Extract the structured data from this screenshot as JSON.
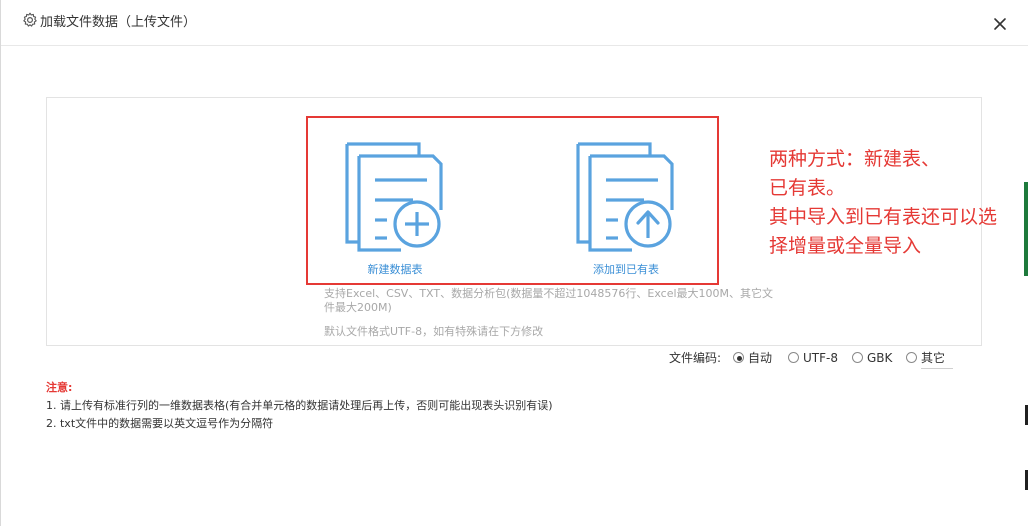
{
  "dialog": {
    "title": "加载文件数据（上传文件）",
    "title_icon": "gear-icon",
    "close_icon": "close-icon"
  },
  "upload": {
    "new_table_label": "新建数据表",
    "add_existing_label": "添加到已有表",
    "new_table_icon": "document-plus-icon",
    "add_existing_icon": "document-upload-icon",
    "support_text": "支持Excel、CSV、TXT、数据分析包(数据量不超过1048576行、Excel最大100M、其它文件最大200M)",
    "default_encoding_text": "默认文件格式UTF-8，如有特殊请在下方修改"
  },
  "annotation": {
    "line1": "两种方式：新建表、",
    "line2": "已有表。",
    "line3": "其中导入到已有表还可以选",
    "line4": "择增量或全量导入",
    "color": "#e53935"
  },
  "encoding": {
    "label": "文件编码:",
    "options": [
      "自动",
      "UTF-8",
      "GBK",
      "其它"
    ],
    "selected": "自动"
  },
  "notes": {
    "title": "注意:",
    "items": [
      "1. 请上传有标准行列的一维数据表格(有合并单元格的数据请处理后再上传，否则可能出现表头识别有误)",
      "2. txt文件中的数据需要以英文逗号作为分隔符"
    ]
  },
  "colors": {
    "accent": "#3b8fd6",
    "icon": "#5aa3df",
    "highlight": "#e53935",
    "muted": "#a8a8a8"
  }
}
